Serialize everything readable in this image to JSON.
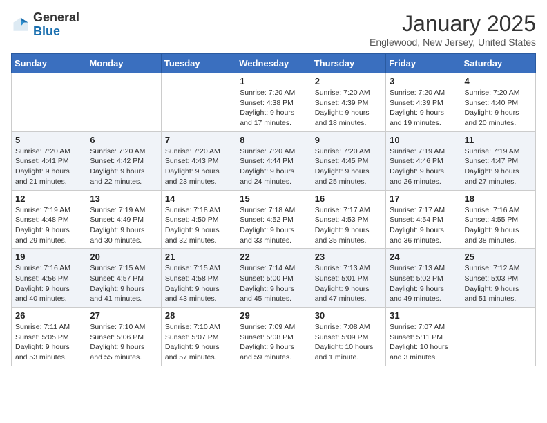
{
  "logo": {
    "general": "General",
    "blue": "Blue"
  },
  "title": "January 2025",
  "location": "Englewood, New Jersey, United States",
  "weekdays": [
    "Sunday",
    "Monday",
    "Tuesday",
    "Wednesday",
    "Thursday",
    "Friday",
    "Saturday"
  ],
  "weeks": [
    [
      {
        "day": "",
        "info": ""
      },
      {
        "day": "",
        "info": ""
      },
      {
        "day": "",
        "info": ""
      },
      {
        "day": "1",
        "info": "Sunrise: 7:20 AM\nSunset: 4:38 PM\nDaylight: 9 hours\nand 17 minutes."
      },
      {
        "day": "2",
        "info": "Sunrise: 7:20 AM\nSunset: 4:39 PM\nDaylight: 9 hours\nand 18 minutes."
      },
      {
        "day": "3",
        "info": "Sunrise: 7:20 AM\nSunset: 4:39 PM\nDaylight: 9 hours\nand 19 minutes."
      },
      {
        "day": "4",
        "info": "Sunrise: 7:20 AM\nSunset: 4:40 PM\nDaylight: 9 hours\nand 20 minutes."
      }
    ],
    [
      {
        "day": "5",
        "info": "Sunrise: 7:20 AM\nSunset: 4:41 PM\nDaylight: 9 hours\nand 21 minutes."
      },
      {
        "day": "6",
        "info": "Sunrise: 7:20 AM\nSunset: 4:42 PM\nDaylight: 9 hours\nand 22 minutes."
      },
      {
        "day": "7",
        "info": "Sunrise: 7:20 AM\nSunset: 4:43 PM\nDaylight: 9 hours\nand 23 minutes."
      },
      {
        "day": "8",
        "info": "Sunrise: 7:20 AM\nSunset: 4:44 PM\nDaylight: 9 hours\nand 24 minutes."
      },
      {
        "day": "9",
        "info": "Sunrise: 7:20 AM\nSunset: 4:45 PM\nDaylight: 9 hours\nand 25 minutes."
      },
      {
        "day": "10",
        "info": "Sunrise: 7:19 AM\nSunset: 4:46 PM\nDaylight: 9 hours\nand 26 minutes."
      },
      {
        "day": "11",
        "info": "Sunrise: 7:19 AM\nSunset: 4:47 PM\nDaylight: 9 hours\nand 27 minutes."
      }
    ],
    [
      {
        "day": "12",
        "info": "Sunrise: 7:19 AM\nSunset: 4:48 PM\nDaylight: 9 hours\nand 29 minutes."
      },
      {
        "day": "13",
        "info": "Sunrise: 7:19 AM\nSunset: 4:49 PM\nDaylight: 9 hours\nand 30 minutes."
      },
      {
        "day": "14",
        "info": "Sunrise: 7:18 AM\nSunset: 4:50 PM\nDaylight: 9 hours\nand 32 minutes."
      },
      {
        "day": "15",
        "info": "Sunrise: 7:18 AM\nSunset: 4:52 PM\nDaylight: 9 hours\nand 33 minutes."
      },
      {
        "day": "16",
        "info": "Sunrise: 7:17 AM\nSunset: 4:53 PM\nDaylight: 9 hours\nand 35 minutes."
      },
      {
        "day": "17",
        "info": "Sunrise: 7:17 AM\nSunset: 4:54 PM\nDaylight: 9 hours\nand 36 minutes."
      },
      {
        "day": "18",
        "info": "Sunrise: 7:16 AM\nSunset: 4:55 PM\nDaylight: 9 hours\nand 38 minutes."
      }
    ],
    [
      {
        "day": "19",
        "info": "Sunrise: 7:16 AM\nSunset: 4:56 PM\nDaylight: 9 hours\nand 40 minutes."
      },
      {
        "day": "20",
        "info": "Sunrise: 7:15 AM\nSunset: 4:57 PM\nDaylight: 9 hours\nand 41 minutes."
      },
      {
        "day": "21",
        "info": "Sunrise: 7:15 AM\nSunset: 4:58 PM\nDaylight: 9 hours\nand 43 minutes."
      },
      {
        "day": "22",
        "info": "Sunrise: 7:14 AM\nSunset: 5:00 PM\nDaylight: 9 hours\nand 45 minutes."
      },
      {
        "day": "23",
        "info": "Sunrise: 7:13 AM\nSunset: 5:01 PM\nDaylight: 9 hours\nand 47 minutes."
      },
      {
        "day": "24",
        "info": "Sunrise: 7:13 AM\nSunset: 5:02 PM\nDaylight: 9 hours\nand 49 minutes."
      },
      {
        "day": "25",
        "info": "Sunrise: 7:12 AM\nSunset: 5:03 PM\nDaylight: 9 hours\nand 51 minutes."
      }
    ],
    [
      {
        "day": "26",
        "info": "Sunrise: 7:11 AM\nSunset: 5:05 PM\nDaylight: 9 hours\nand 53 minutes."
      },
      {
        "day": "27",
        "info": "Sunrise: 7:10 AM\nSunset: 5:06 PM\nDaylight: 9 hours\nand 55 minutes."
      },
      {
        "day": "28",
        "info": "Sunrise: 7:10 AM\nSunset: 5:07 PM\nDaylight: 9 hours\nand 57 minutes."
      },
      {
        "day": "29",
        "info": "Sunrise: 7:09 AM\nSunset: 5:08 PM\nDaylight: 9 hours\nand 59 minutes."
      },
      {
        "day": "30",
        "info": "Sunrise: 7:08 AM\nSunset: 5:09 PM\nDaylight: 10 hours\nand 1 minute."
      },
      {
        "day": "31",
        "info": "Sunrise: 7:07 AM\nSunset: 5:11 PM\nDaylight: 10 hours\nand 3 minutes."
      },
      {
        "day": "",
        "info": ""
      }
    ]
  ]
}
